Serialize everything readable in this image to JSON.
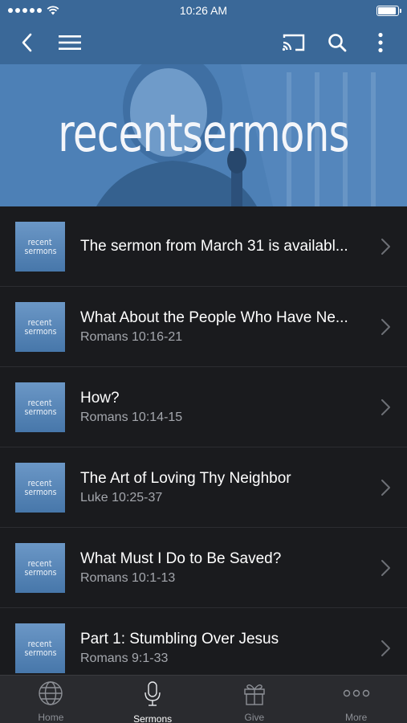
{
  "status_bar": {
    "time": "10:26 AM"
  },
  "nav": {
    "icons": [
      "back-icon",
      "menu-icon",
      "cast-icon",
      "search-icon",
      "more-vertical-icon"
    ]
  },
  "hero": {
    "title": "recentsermons"
  },
  "thumbnail": {
    "line1": "recent",
    "line2": "sermons"
  },
  "sermons": [
    {
      "title": "The sermon from March 31 is availabl...",
      "subtitle": ""
    },
    {
      "title": "What About the People Who Have Ne...",
      "subtitle": "Romans 10:16-21"
    },
    {
      "title": "How?",
      "subtitle": "Romans 10:14-15"
    },
    {
      "title": "The Art of Loving Thy Neighbor",
      "subtitle": "Luke 10:25-37"
    },
    {
      "title": "What Must I Do to Be Saved?",
      "subtitle": "Romans 10:1-13"
    },
    {
      "title": "Part 1: Stumbling Over Jesus",
      "subtitle": "Romans 9:1-33"
    }
  ],
  "tabs": [
    {
      "label": "Home",
      "icon": "globe-icon",
      "active": false
    },
    {
      "label": "Sermons",
      "icon": "microphone-icon",
      "active": true
    },
    {
      "label": "Give",
      "icon": "gift-icon",
      "active": false
    },
    {
      "label": "More",
      "icon": "more-horizontal-icon",
      "active": false
    }
  ],
  "colors": {
    "nav_blue": "#3a6898",
    "list_bg": "#1a1b1e",
    "tab_bg": "#2a2b2f"
  }
}
